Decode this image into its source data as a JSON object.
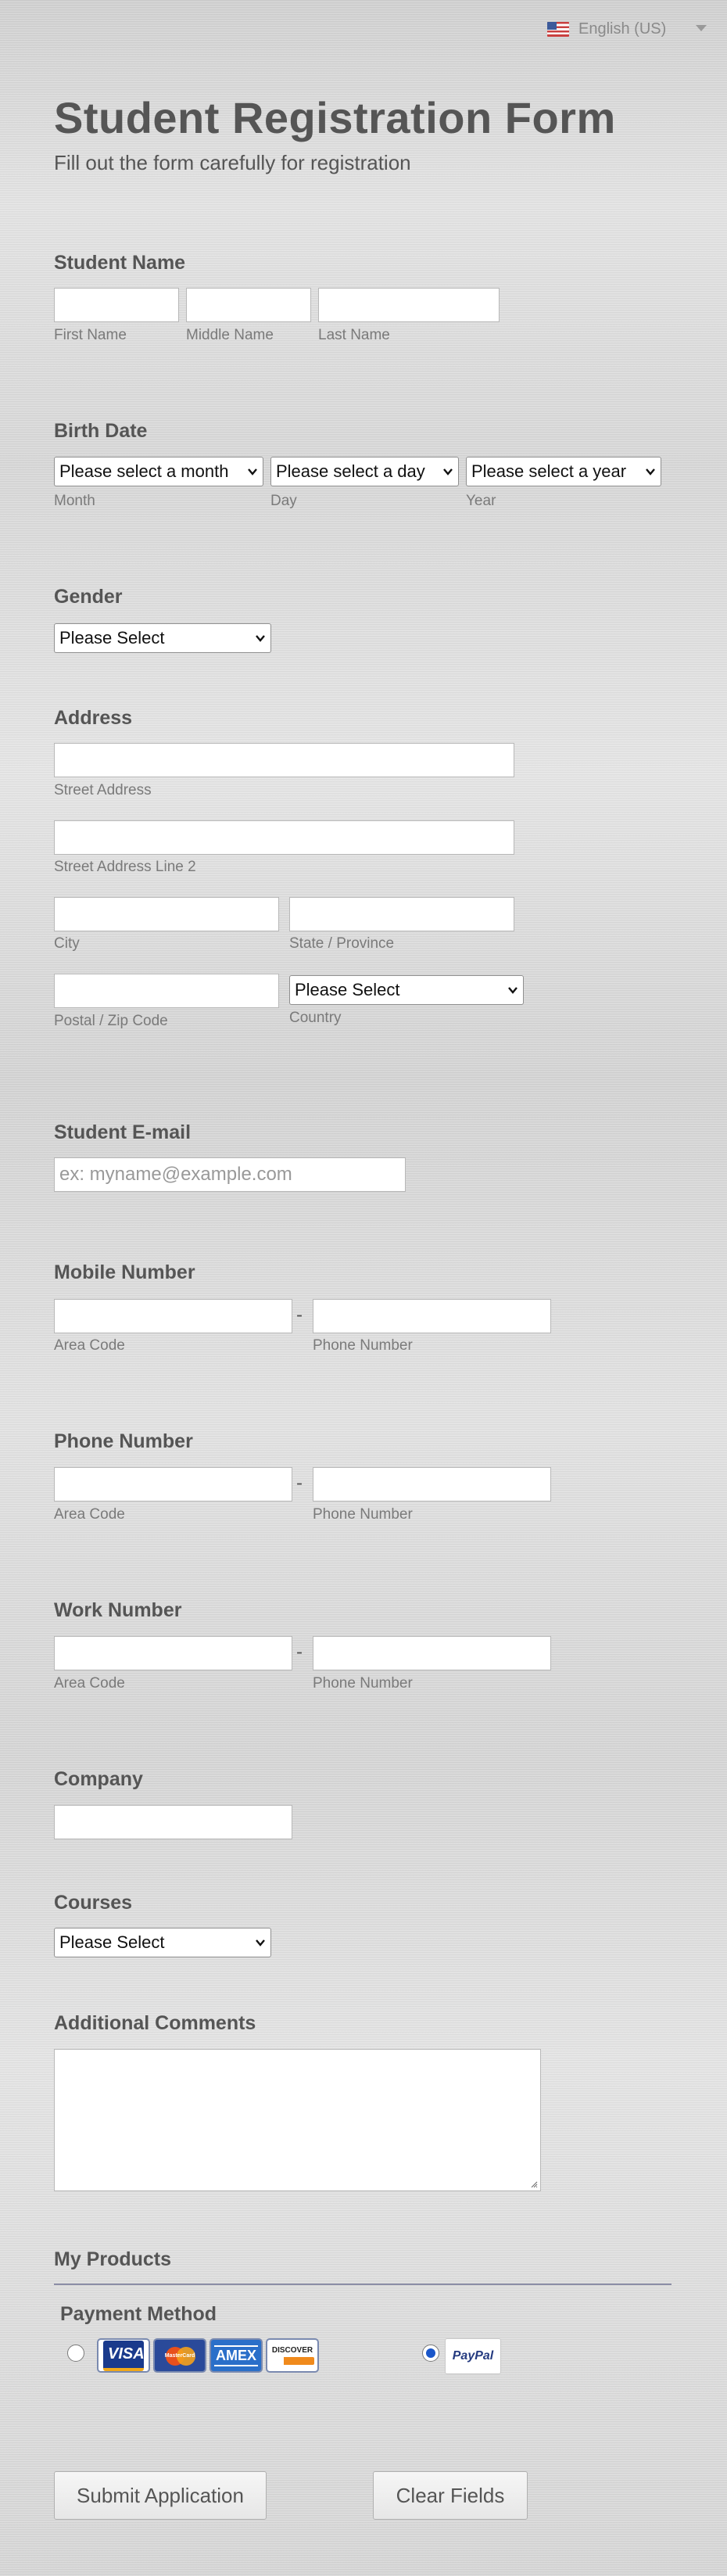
{
  "language": {
    "selected": "English (US)"
  },
  "form": {
    "title": "Student Registration Form",
    "subtitle": "Fill out the form carefully for registration"
  },
  "student_name": {
    "label": "Student Name",
    "first": "First Name",
    "middle": "Middle Name",
    "last": "Last Name"
  },
  "birth_date": {
    "label": "Birth Date",
    "month_placeholder": "Please select a month",
    "day_placeholder": "Please select a day",
    "year_placeholder": "Please select a year",
    "month": "Month",
    "day": "Day",
    "year": "Year"
  },
  "gender": {
    "label": "Gender",
    "selected": "Please Select"
  },
  "address": {
    "label": "Address",
    "street": "Street Address",
    "street2": "Street Address Line 2",
    "city": "City",
    "state": "State / Province",
    "postal": "Postal / Zip Code",
    "country": "Country",
    "country_selected": "Please Select"
  },
  "email": {
    "label": "Student E-mail",
    "placeholder": "ex: myname@example.com"
  },
  "mobile": {
    "label": "Mobile Number",
    "area": "Area Code",
    "phone": "Phone Number",
    "separator": "-"
  },
  "phone": {
    "label": "Phone Number",
    "area": "Area Code",
    "phone": "Phone Number",
    "separator": "-"
  },
  "work": {
    "label": "Work Number",
    "area": "Area Code",
    "phone": "Phone Number",
    "separator": "-"
  },
  "company": {
    "label": "Company"
  },
  "courses": {
    "label": "Courses",
    "selected": "Please Select"
  },
  "comments": {
    "label": "Additional Comments"
  },
  "products": {
    "label": "My Products"
  },
  "payment": {
    "label": "Payment Method",
    "cards": [
      "VISA",
      "MasterCard",
      "AMEX",
      "DISCOVER"
    ],
    "paypal": "PayPal",
    "selected": "paypal",
    "colors": {
      "visa": "#1a3a8c",
      "mastercard": "#e8501c",
      "amex": "#2a6fc9",
      "radio": "#1a56c9"
    }
  },
  "buttons": {
    "submit": "Submit Application",
    "clear": "Clear Fields"
  }
}
